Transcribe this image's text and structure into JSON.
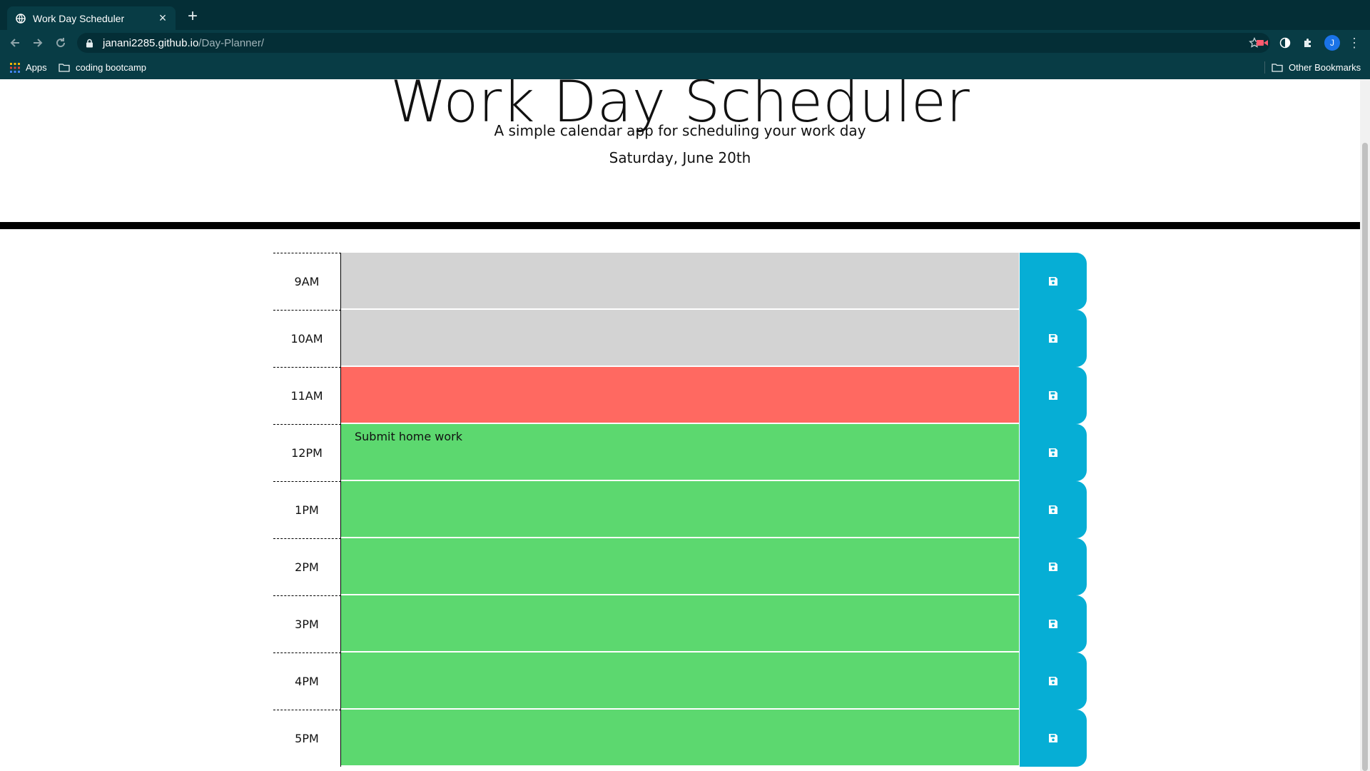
{
  "browser": {
    "tab_title": "Work Day Scheduler",
    "new_tab_symbol": "+",
    "url_host": "janani2285.github.io",
    "url_path": "/Day-Planner/",
    "profile_initial": "J",
    "bookmarks": {
      "apps": "Apps",
      "folder1": "coding bootcamp",
      "other": "Other Bookmarks"
    }
  },
  "header": {
    "title": "Work Day Scheduler",
    "subtitle": "A simple calendar app for scheduling your work day",
    "current_day": "Saturday, June 20th"
  },
  "colors": {
    "past": "#d3d3d3",
    "present": "#ff6961",
    "future": "#5cd86f",
    "save": "#06aed5"
  },
  "schedule": [
    {
      "hour": "9AM",
      "text": "",
      "state": "past"
    },
    {
      "hour": "10AM",
      "text": "",
      "state": "past"
    },
    {
      "hour": "11AM",
      "text": "",
      "state": "present"
    },
    {
      "hour": "12PM",
      "text": "Submit home work",
      "state": "future"
    },
    {
      "hour": "1PM",
      "text": "",
      "state": "future"
    },
    {
      "hour": "2PM",
      "text": "",
      "state": "future"
    },
    {
      "hour": "3PM",
      "text": "",
      "state": "future"
    },
    {
      "hour": "4PM",
      "text": "",
      "state": "future"
    },
    {
      "hour": "5PM",
      "text": "",
      "state": "future"
    }
  ]
}
